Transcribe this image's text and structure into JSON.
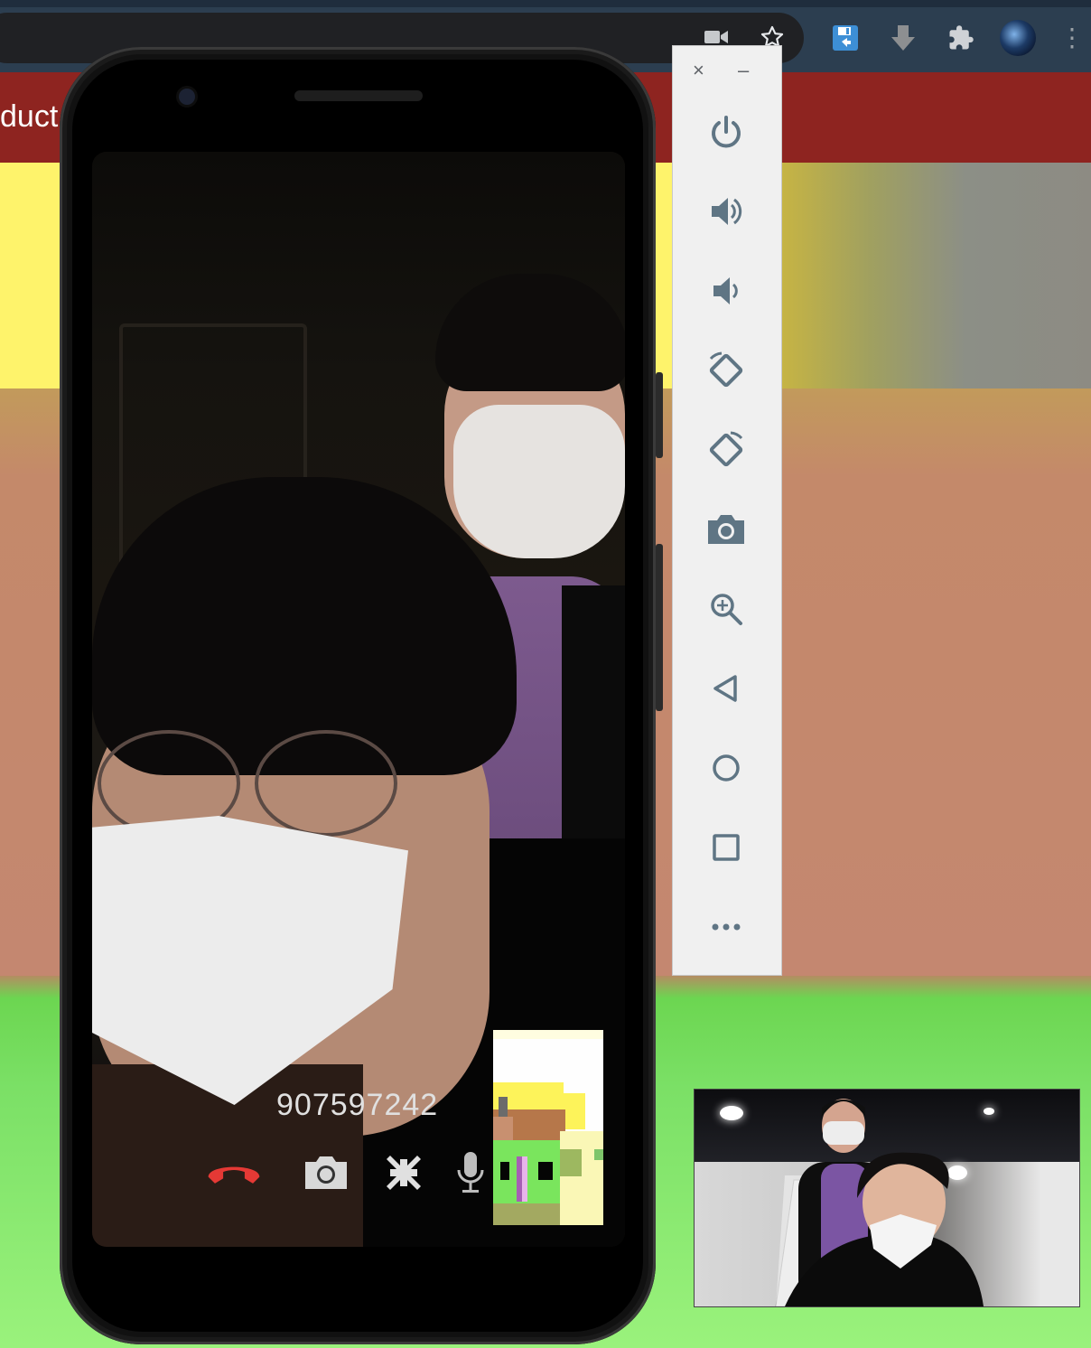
{
  "browser": {
    "icons": [
      "video-camera-icon",
      "star-icon",
      "save-extension-icon",
      "download-icon",
      "puzzle-extension-icon",
      "profile-avatar",
      "more-options-icon"
    ]
  },
  "page": {
    "header_partial_title": "duct",
    "colors": {
      "header": "#8e2420",
      "yellow": "#fef36b",
      "orange": "#c48770",
      "green": "#7be066"
    }
  },
  "call": {
    "caller_id": "907597242",
    "controls": [
      "end-call-icon",
      "camera-icon",
      "minimize-screen-icon",
      "microphone-icon"
    ],
    "end_call_color": "#e53935"
  },
  "emulator_toolbar": {
    "window_controls": {
      "close": "×",
      "minimize": "–"
    },
    "buttons": [
      "power",
      "volume-up",
      "volume-down",
      "rotate-left",
      "rotate-right",
      "screenshot",
      "zoom",
      "back",
      "home",
      "overview",
      "more"
    ]
  }
}
